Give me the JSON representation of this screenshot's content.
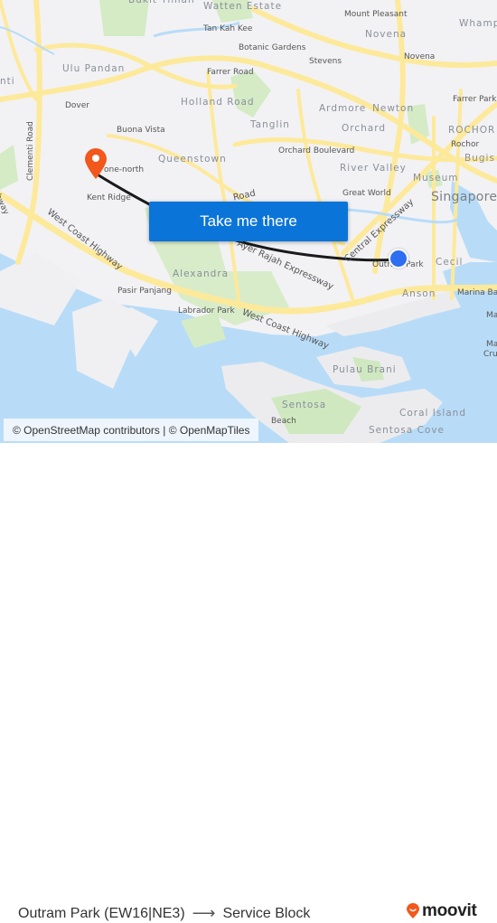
{
  "map": {
    "labels": {
      "bukit_timah": "Bukit Timah",
      "watten_estate": "Watten Estate",
      "mount_pleasant": "Mount Pleasant",
      "tan_kah_kee": "Tan Kah Kee",
      "novena_district": "Novena",
      "novena_station": "Novena",
      "whampoa": "Whampoa",
      "botanic_gardens": "Botanic Gardens",
      "stevens": "Stevens",
      "ulu_pandan": "Ulu Pandan",
      "clementi": "nti",
      "farrer_road": "Farrer Road",
      "farrer_park": "Farrer Park",
      "holland_road": "Holland Road",
      "dover": "Dover",
      "ardmore": "Ardmore",
      "newton": "Newton",
      "tanglin": "Tanglin",
      "orchard": "Orchard",
      "rochor_district": "ROCHOR",
      "rochor": "Rochor",
      "buona_vista": "Buona Vista",
      "clementi_road": "Clementi Road",
      "queenstown": "Queenstown",
      "one_north": "one-north",
      "orchard_boulevard": "Orchard Boulevard",
      "bugis": "Bugis",
      "river_valley": "River Valley",
      "museum": "Museum",
      "highway_left": "Highway",
      "kent_ridge": "Kent Ridge",
      "great_world": "Great World",
      "singapore": "Singapore",
      "road_fragment": "Road",
      "west_coast_highway_1": "West Coast Highway",
      "ayer_rajah": "Ayer Rajah Expressway",
      "central_expressway": "Central Expressway",
      "outram_park": "Outram Park",
      "cecil": "Cecil",
      "alexandra": "Alexandra",
      "pasir_panjang": "Pasir Panjang",
      "anson": "Anson",
      "marina_bay": "Marina Bay",
      "labrador_park": "Labrador Park",
      "west_coast_highway_2": "West Coast Highway",
      "ma1": "Ma",
      "ma2": "Ma",
      "cruise": "Crui",
      "pulau_brani": "Pulau Brani",
      "sentosa": "Sentosa",
      "beach": "Beach",
      "coral_island": "Coral Island",
      "sentosa_cove": "Sentosa Cove"
    },
    "cta_label": "Take me there",
    "attribution": "© OpenStreetMap contributors | © OpenMapTiles",
    "icons": {
      "destination_pin": "map-pin-icon",
      "origin_dot": "current-location-icon"
    },
    "colors": {
      "water": "#b8dcf8",
      "land": "#f2f2f4",
      "park": "#cfe8c0",
      "road": "#fde99a",
      "route": "#1a1a1a",
      "cta": "#0b74d8",
      "pin": "#f2571b",
      "origin": "#2d6ff0"
    }
  },
  "footer": {
    "origin": "Outram Park (EW16|NE3)",
    "arrow": "⟶",
    "destination": "Service Block",
    "brand": "moovit",
    "brand_color": "#f2571b"
  }
}
